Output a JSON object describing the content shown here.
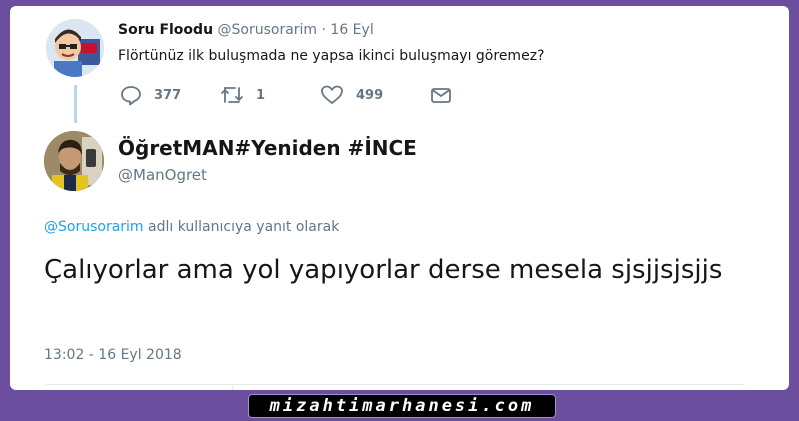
{
  "quoted_tweet": {
    "display_name": "Soru Floodu",
    "handle": "@Sorusorarim",
    "separator": " · ",
    "date": "16 Eyl",
    "text": "Flörtünüz ilk buluşmada ne yapsa ikinci buluşmayı göremez?",
    "reply_count": "377",
    "retweet_count": "1",
    "like_count": "499"
  },
  "tweet": {
    "display_name": "ÖğretMAN#Yeniden #İNCE",
    "handle": "@ManOgret",
    "reply_mention": "@Sorusorarim",
    "reply_suffix": " adlı kullanıcıya yanıt olarak",
    "text": "Çalıyorlar ama yol yapıyorlar derse mesela sjsjjsjsjjs",
    "timestamp": "13:02 - 16 Eyl 2018"
  },
  "watermark": "mizahtimarhanesi.com",
  "colors": {
    "background": "#6b4f9e",
    "link": "#1da1f2",
    "muted_text": "#657786",
    "thread_line": "#b8d8f0"
  }
}
